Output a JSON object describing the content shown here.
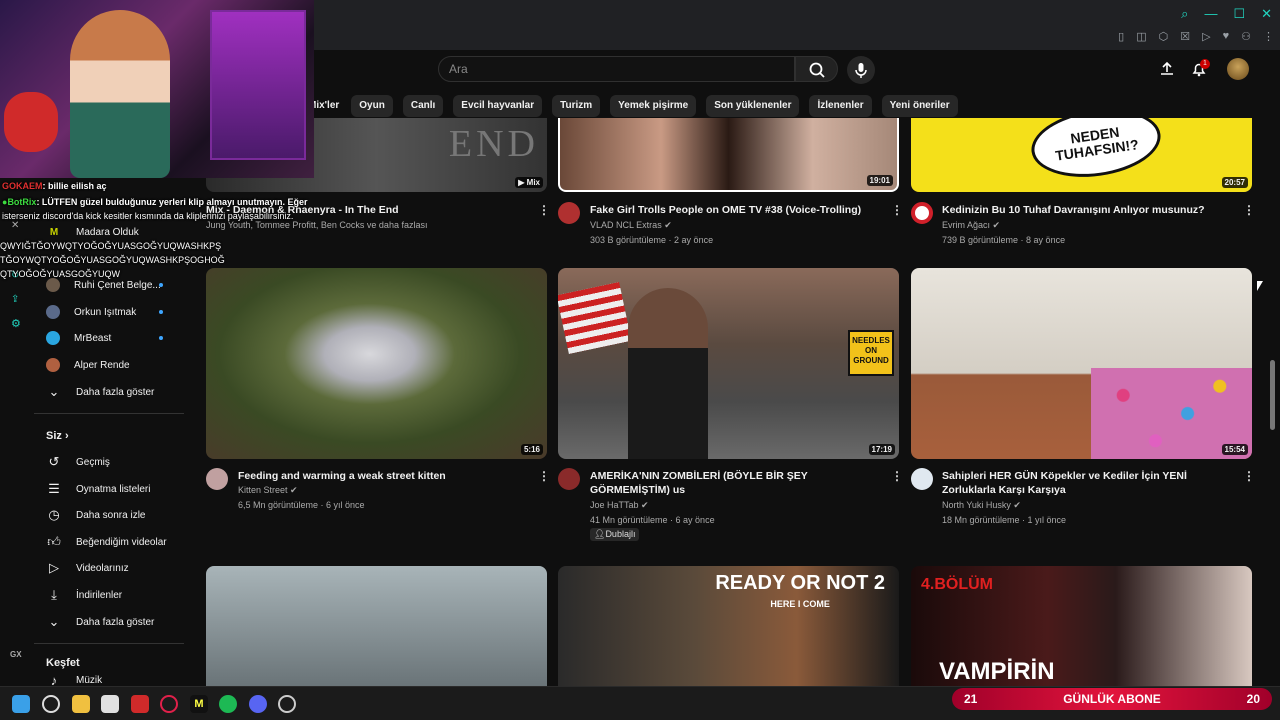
{
  "header": {
    "search_placeholder": "Ara",
    "notification_count": "1"
  },
  "chips": [
    "Mix'ler",
    "Oyun",
    "Canlı",
    "Evcil hayvanlar",
    "Turizm",
    "Yemek pişirme",
    "Son yüklenenler",
    "İzlenenler",
    "Yeni öneriler"
  ],
  "sidebar": {
    "subscriptions": [
      "Madara Olduk",
      "Ruhi Çenet Belge...",
      "Orkun Işıtmak",
      "MrBeast",
      "Alper Rende"
    ],
    "show_more": "Daha fazla göster",
    "you_label": "Siz",
    "you_items": [
      "Geçmiş",
      "Oynatma listeleri",
      "Daha sonra izle",
      "Beğendiğim videolar",
      "Videolarınız",
      "İndirilenler",
      "Daha fazla göster"
    ],
    "explore_label": "Keşfet",
    "explore_items": [
      "Müzik"
    ]
  },
  "videos": [
    {
      "title": "Mix - Daemon & Rhaenyra - In The End",
      "meta1": "Jung Youth, Tommee Profitt, Ben Cocks ve daha fazlası",
      "meta2": "",
      "badge": "Mix",
      "duration": ""
    },
    {
      "title": "Fake Girl Trolls People on OME TV #38 (Voice-Trolling)",
      "meta1": "VLAD NCL Extras",
      "meta2": "303 B görüntüleme · 2 ay önce",
      "duration": "19:01"
    },
    {
      "title": "Kedinizin Bu 10 Tuhaf Davranışını Anlıyor musunuz?",
      "meta1": "Evrim Ağacı",
      "meta2": "739 B görüntüleme · 8 ay önce",
      "duration": "20:57"
    },
    {
      "title": "Feeding and warming a weak street kitten",
      "meta1": "Kitten Street",
      "meta2": "6,5 Mn görüntüleme · 6 yıl önce",
      "duration": "5:16"
    },
    {
      "title": "AMERİKA'NIN ZOMBİLERİ (BÖYLE BİR ŞEY GÖRMEMİŞTİM) us",
      "meta1": "Joe HaTTab",
      "meta2": "41 Mn görüntüleme · 6 ay önce",
      "tag": "Dublajlı",
      "duration": "17:19"
    },
    {
      "title": "Sahipleri HER GÜN Köpekler ve Kediler İçin YENİ Zorluklarla Karşı Karşıya",
      "meta1": "North Yuki Husky",
      "meta2": "18 Mn görüntüleme · 1 yıl önce",
      "duration": "15:54"
    }
  ],
  "thumb_text": {
    "tuhaf": "NEDEN TUHAFSIN!?",
    "end": "END",
    "needles": "NEEDLES ON GROUND",
    "ready": "READY OR NOT 2",
    "ready_sub": "HERE I COME",
    "bolum": "4.BÖLÜM",
    "vampir": "VAMPİRİN"
  },
  "chat": [
    {
      "user": "GOKAEM",
      "msg": ": billie eilish aç"
    },
    {
      "user": "BotRix",
      "msg": ": LÜTFEN güzel bulduğunuz yerleri klip almayı unutmayın. Eğer"
    },
    {
      "user": "",
      "msg": "isterseniz discord'da kick kesitler kısmında da kliplerinizi paylaşabilirsiniz."
    },
    {
      "user": "",
      "msg": "QWYIĞTĞOYWQTYOĞOĞYUASGOĞYUQWASHKPŞ"
    },
    {
      "user": "",
      "msg": "TĞOYWQTYOĞOĞYUASGOĞYUQWASHKPŞOGHOĞ"
    },
    {
      "user": "",
      "msg": "QTYOĞOĞYUASGOĞYUQW"
    }
  ],
  "overlay": {
    "left": "21",
    "label": "GÜNLÜK ABONE",
    "right": "20"
  },
  "colors": {
    "accent": "#21d5c0",
    "yt_red": "#ff0000",
    "link_blue": "#3ea6ff",
    "abone_red": "#e2143c"
  }
}
